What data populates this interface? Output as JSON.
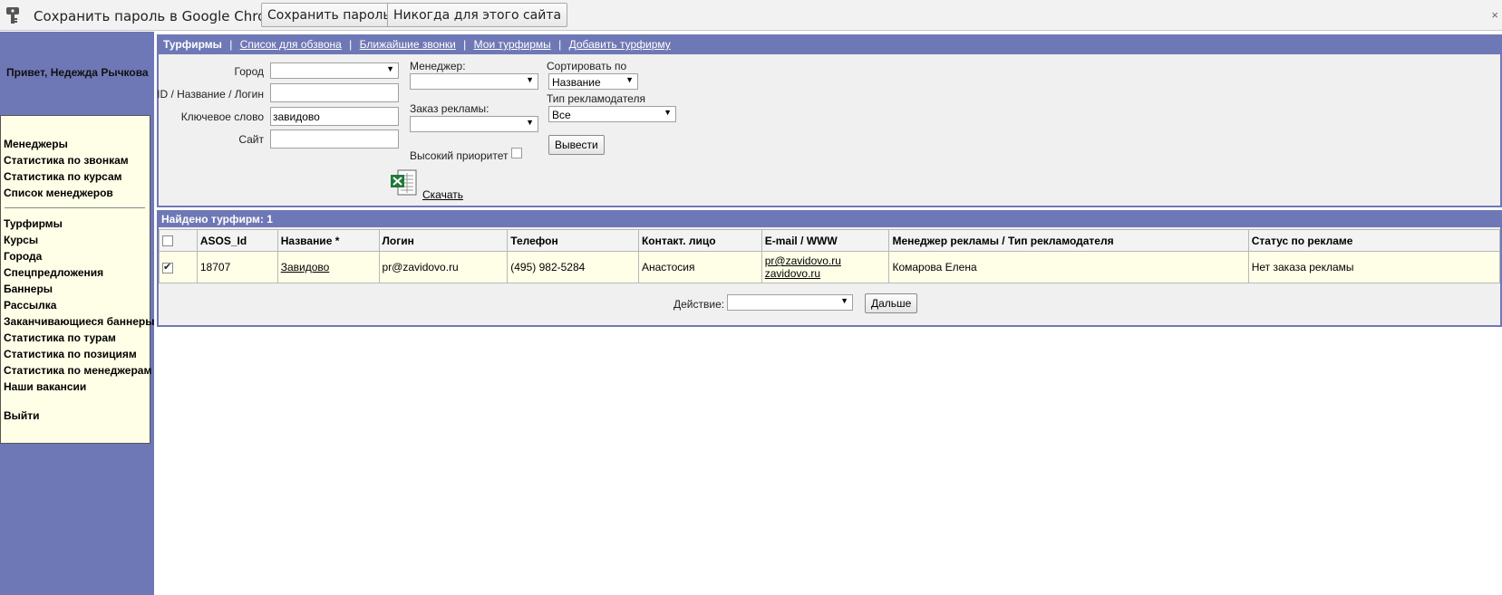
{
  "password_bar": {
    "prompt": "Сохранить пароль в Google Chrome?",
    "save_button": "Сохранить пароль",
    "never_button": "Никогда для этого сайта",
    "close": "×"
  },
  "sidebar": {
    "greeting": "Привет, Недежда Рычкова",
    "group1": [
      "Менеджеры",
      "Статистика по звонкам",
      "Статистика по курсам",
      "Список менеджеров"
    ],
    "group2": [
      "Турфирмы",
      "Курсы",
      "Города",
      "Спецпредложения",
      "Баннеры",
      "Рассылка",
      "Заканчивающиеся баннеры",
      "Статистика по турам",
      "Статистика по позициям",
      "Статистика по менеджерам",
      "Наши вакансии"
    ],
    "logout": "Выйти"
  },
  "topnav": {
    "current": "Турфирмы",
    "links": [
      "Список для обзвона",
      "Ближайшие звонки",
      "Мои турфирмы",
      "Добавить турфирму"
    ],
    "separator": "|"
  },
  "filters": {
    "city_label": "Город",
    "city_value": "",
    "id_label": "ID / Название / Логин",
    "id_value": "",
    "keyword_label": "Ключевое слово",
    "keyword_value": "завидово",
    "site_label": "Сайт",
    "site_value": "",
    "manager_label": "Менеджер:",
    "manager_value": "",
    "ad_order_label": "Заказ рекламы:",
    "ad_order_value": "",
    "priority_label": "Высокий приоритет",
    "sort_label": "Сортировать по",
    "sort_value": "Название",
    "advertiser_type_label": "Тип рекламодателя",
    "advertiser_type_value": "Все",
    "submit_button": "Вывести",
    "download_link": "Скачать"
  },
  "results": {
    "found_label": "Найдено турфирм: 1",
    "columns": [
      "ASOS_Id",
      "Название *",
      "Логин",
      "Телефон",
      "Контакт. лицо",
      "E-mail / WWW",
      "Менеджер рекламы / Тип рекламодателя",
      "Статус по рекламе"
    ],
    "rows": [
      {
        "checked": true,
        "id": "18707",
        "name": "Завидово",
        "login": "pr@zavidovo.ru",
        "phone": "(495) 982-5284",
        "contact": "Анастосия",
        "email": "pr@zavidovo.ru",
        "www": "zavidovo.ru",
        "manager": "Комарова Елена",
        "status": "Нет заказа рекламы"
      }
    ],
    "action_label": "Действие:",
    "action_value": "",
    "next_button": "Дальше"
  },
  "colors": {
    "accent": "#6f78b6",
    "menu_bg": "#ffffe8",
    "panel_bg": "#f0f0f0"
  },
  "icons": [
    "key-icon",
    "excel-icon",
    "close-icon"
  ]
}
